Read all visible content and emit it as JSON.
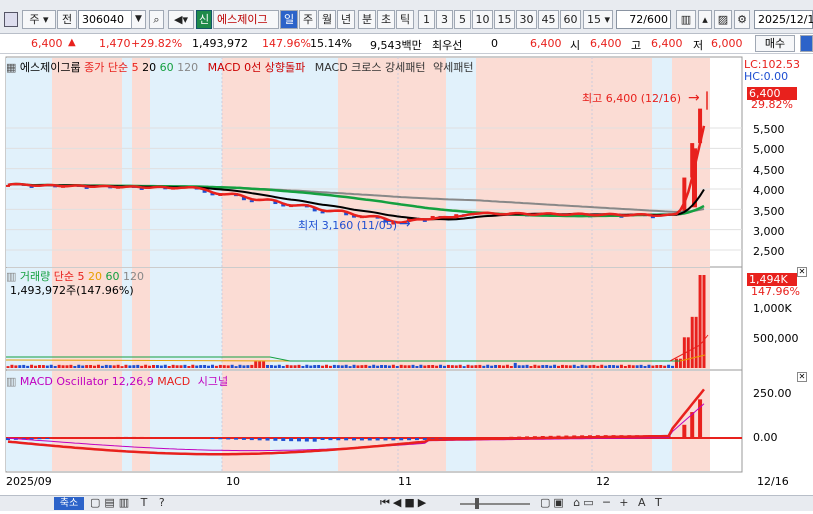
{
  "toolbar": {
    "market": "주",
    "market_kind": "전",
    "code": "306040",
    "name": "에스제이그",
    "new_badge": "신",
    "periods": [
      "일",
      "주",
      "월",
      "년"
    ],
    "active_period": "일",
    "intraday": [
      "분",
      "초",
      "틱"
    ],
    "nums": [
      "1",
      "3",
      "5",
      "10",
      "15",
      "30",
      "45",
      "60"
    ],
    "interval": "15",
    "count": "72",
    "count_total": "/600",
    "date": "2025/12/1"
  },
  "quote": {
    "price": "6,400",
    "change": "1,470",
    "change_pct": "+29.82%",
    "volume": "1,493,972",
    "vol_ratio": "147.96%",
    "turnover_pct": "15.14%",
    "amount": "9,543백만",
    "pref_label": "최우선",
    "pref_value": "0",
    "ask": "6,400",
    "open_label": "시",
    "open": "6,400",
    "high_label": "고",
    "high": "6,400",
    "low_label": "저",
    "low": "6,000",
    "buy_button": "매수"
  },
  "price_panel": {
    "legend": {
      "name": "에스제이그룹",
      "ma_label": "종가 단순",
      "ma_values": [
        "5",
        "20",
        "60",
        "120"
      ],
      "macd0": "MACD 0선 상향돌파",
      "cross": "MACD 크로스 강세패턴",
      "weak": "약세패턴"
    },
    "lc": "LC:102.53",
    "hc": "HC:0.00",
    "current_tag": "6,400",
    "current_pct": "29.82%",
    "axis": [
      "5,500",
      "5,000",
      "4,500",
      "4,000",
      "3,500",
      "3,000",
      "2,500"
    ],
    "high_note": "최고 6,400 (12/16)",
    "low_note": "최저 3,160 (11/05)"
  },
  "volume_panel": {
    "title": "거래량",
    "ma_label": "단순",
    "ma_values": [
      "5",
      "20",
      "60",
      "120"
    ],
    "current": "1,493,972주(147.96%)",
    "tag": "1,494K",
    "tag_pct": "147.96%",
    "axis": [
      "1,000K",
      "500,000"
    ]
  },
  "macd_panel": {
    "title": "MACD Oscillator 12,26,9",
    "macd": "MACD",
    "signal": "시그널",
    "axis": [
      "250.00",
      "0.00"
    ]
  },
  "x_axis": [
    "2025/09",
    "10",
    "11",
    "12",
    "12/16"
  ],
  "bottom": {
    "zoom_label": "축소"
  },
  "colors": {
    "up": "#e8211d",
    "down": "#1f4fd1",
    "ma5": "#e8211d",
    "ma20": "#000000",
    "ma60": "#14a040",
    "ma120": "#888888",
    "bg_red": "#fbdcd4",
    "bg_blue": "#e1f1fb"
  },
  "chart_data": {
    "type": "candlestick",
    "x": [
      "2025/09",
      "10",
      "11",
      "12",
      "12/16"
    ],
    "high": 6400,
    "low": 3160,
    "close_last": 6400,
    "ylim": [
      2500,
      5700
    ],
    "ma_periods": [
      5,
      20,
      60,
      120
    ],
    "volume_last": 1493972,
    "macd_params": "12,26,9"
  }
}
